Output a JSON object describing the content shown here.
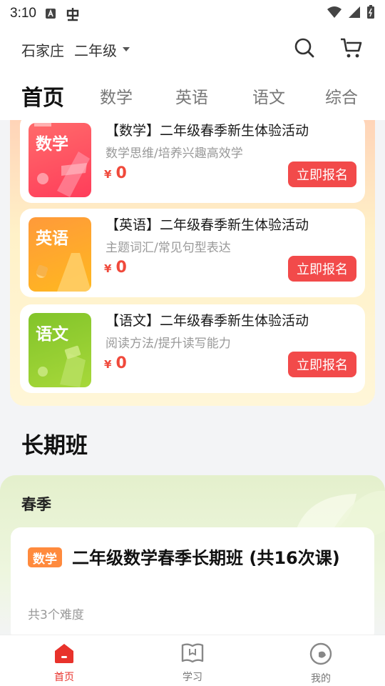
{
  "status": {
    "time": "3:10"
  },
  "header": {
    "city": "石家庄",
    "grade": "二年级"
  },
  "tabs": [
    {
      "label": "首页"
    },
    {
      "label": "数学"
    },
    {
      "label": "英语"
    },
    {
      "label": "语文"
    },
    {
      "label": "综合"
    }
  ],
  "activities": [
    {
      "thumb": "数学",
      "title": "【数学】二年级春季新生体验活动",
      "subtitle": "数学思维/培养兴趣高效学",
      "currency": "¥",
      "price": "0",
      "button": "立即报名",
      "color": "#ff4d5e"
    },
    {
      "thumb": "英语",
      "title": "【英语】二年级春季新生体验活动",
      "subtitle": "主题词汇/常见句型表达",
      "currency": "¥",
      "price": "0",
      "button": "立即报名",
      "color": "#ffa020"
    },
    {
      "thumb": "语文",
      "title": "【语文】二年级春季新生体验活动",
      "subtitle": "阅读方法/提升读写能力",
      "currency": "¥",
      "price": "0",
      "button": "立即报名",
      "color": "#8ccc2e"
    }
  ],
  "long_class": {
    "section_title": "长期班",
    "season": "春季",
    "course": {
      "tag": "数学",
      "title": "二年级数学春季长期班 (共16次课)",
      "desc": "共3个难度"
    }
  },
  "bottom_nav": [
    {
      "label": "首页",
      "icon": "home-icon"
    },
    {
      "label": "学习",
      "icon": "book-icon"
    },
    {
      "label": "我的",
      "icon": "profile-icon"
    }
  ]
}
